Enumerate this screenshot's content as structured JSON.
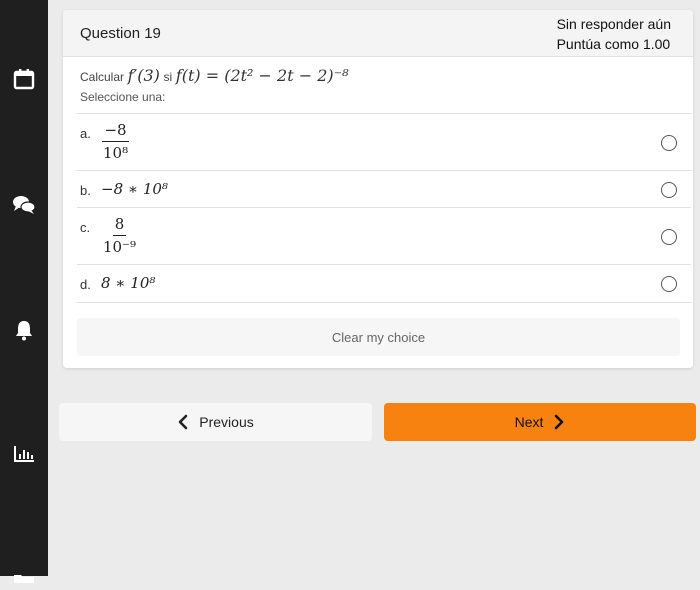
{
  "sidebar": {
    "items": [
      {
        "icon": "calendar-icon"
      },
      {
        "icon": "chat-icon"
      },
      {
        "icon": "bell-icon"
      },
      {
        "icon": "bar-chart-icon"
      },
      {
        "icon": "folder-icon"
      }
    ]
  },
  "question": {
    "number_label": "Question 19",
    "status": "Sin responder aún",
    "grade": "Puntúa como 1.00",
    "prefix": "Calcular",
    "target": "f′(3)",
    "connector": "si",
    "function": "f(t) = (2t² − 2t − 2)⁻⁸",
    "instruction": "Seleccione una:"
  },
  "options": [
    {
      "letter": "a.",
      "numerator": "−8",
      "denominator": "10⁸",
      "selected": false
    },
    {
      "letter": "b.",
      "text": "−8 ∗ 10⁸",
      "selected": false
    },
    {
      "letter": "c.",
      "numerator": "8",
      "denominator": "10⁻⁹",
      "selected": false
    },
    {
      "letter": "d.",
      "text": "8 ∗ 10⁸",
      "selected": false
    }
  ],
  "actions": {
    "clear_label": "Clear my choice",
    "previous_label": "Previous",
    "next_label": "Next"
  },
  "colors": {
    "accent": "#f7820f",
    "sidebar": "#1f1f1f",
    "background": "#ebebeb"
  }
}
